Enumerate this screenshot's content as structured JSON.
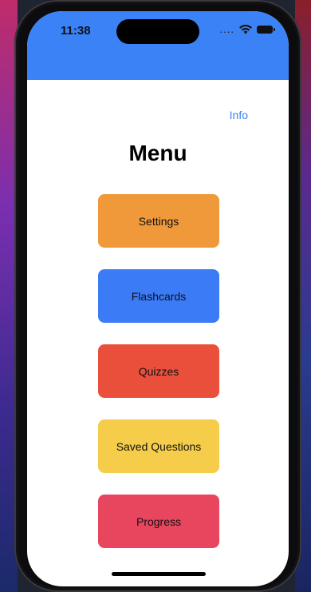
{
  "status_bar": {
    "time": "11:38",
    "signal": "....",
    "wifi_icon": "wifi-icon",
    "battery_icon": "battery-icon"
  },
  "header": {
    "color": "#3b82f6"
  },
  "info_label": "Info",
  "title": "Menu",
  "buttons": [
    {
      "label": "Settings",
      "color": "#f0993a"
    },
    {
      "label": "Flashcards",
      "color": "#3b7bf6"
    },
    {
      "label": "Quizzes",
      "color": "#ea4f3c"
    },
    {
      "label": "Saved Questions",
      "color": "#f6cd4a"
    },
    {
      "label": "Progress",
      "color": "#e8455e"
    }
  ]
}
